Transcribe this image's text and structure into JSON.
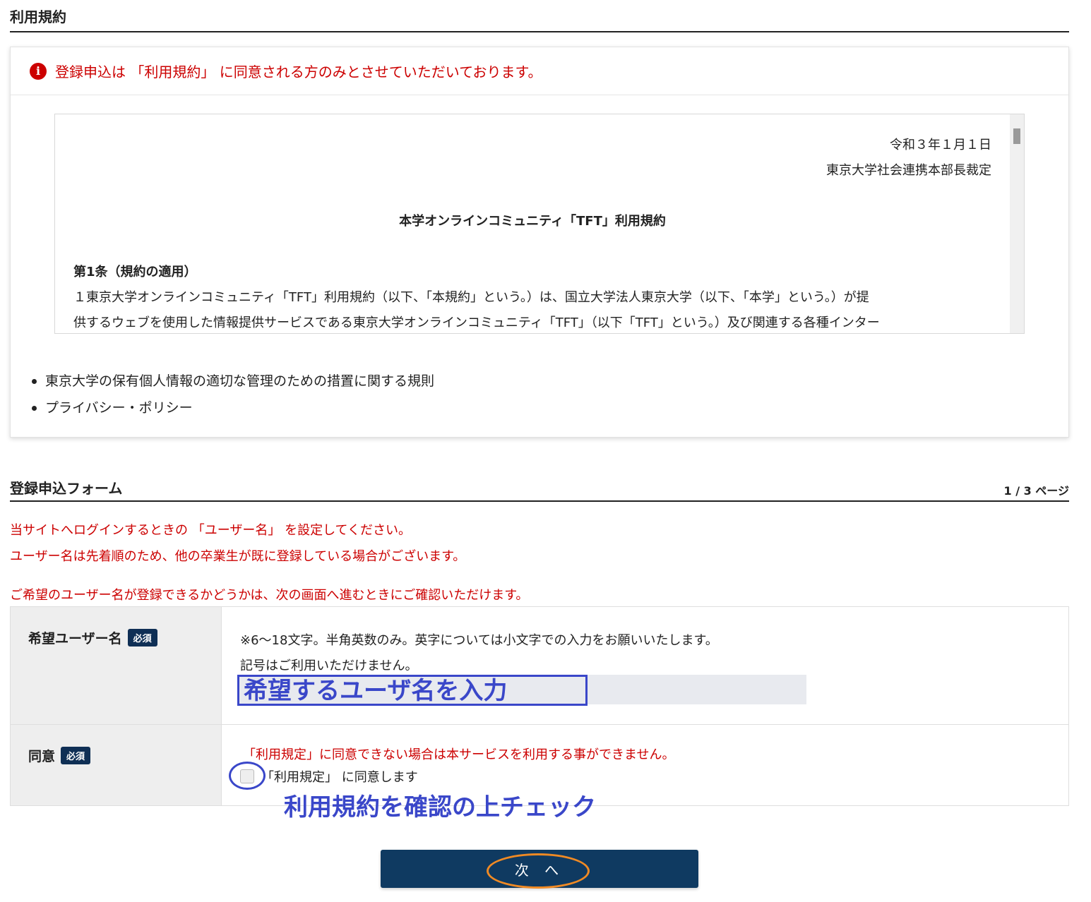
{
  "terms_section": {
    "title": "利用規約",
    "notice": "登録申込は 「利用規約」 に同意される方のみとさせていただいております。",
    "document": {
      "date": "令和３年１月１日",
      "authority": "東京大学社会連携本部長裁定",
      "heading": "本学オンラインコミュニティ「TFT」利用規約",
      "article_title": "第1条（規約の適用）",
      "article_line1": "１東京大学オンラインコミュニティ「TFT」利用規約（以下、「本規約」という。）は、国立大学法人東京大学（以下、「本学」という。）が提",
      "article_line2": "供するウェブを使用した情報提供サービスである東京大学オンラインコミュニティ「TFT」（以下「TFT」という。）及び関連する各種インター"
    },
    "links": [
      "東京大学の保有個人情報の適切な管理のための措置に関する規則",
      "プライバシー・ポリシー"
    ]
  },
  "form_section": {
    "title": "登録申込フォーム",
    "page_indicator": "1 / 3 ページ",
    "instructions": [
      "当サイトへログインするときの 「ユーザー名」 を設定してください。",
      "ユーザー名は先着順のため、他の卒業生が既に登録している場合がございます。",
      "",
      "ご希望のユーザー名が登録できるかどうかは、次の画面へ進むときにご確認いただけます。"
    ],
    "username": {
      "label": "希望ユーザー名",
      "required": "必須",
      "hint1": "※6〜18文字。半角英数のみ。英字については小文字での入力をお願いいたします。",
      "hint2": "記号はご利用いただけません。",
      "annotation": "希望するユーザ名を入力"
    },
    "agree": {
      "label": "同意",
      "required": "必須",
      "warning": "「利用規定」に同意できない場合は本サービスを利用する事ができません。",
      "checkbox_label": "「利用規定」 に同意します",
      "annotation": "利用規約を確認の上チェック"
    },
    "next_button": "次 へ"
  },
  "colors": {
    "notice_red": "#cc0000",
    "navy": "#0f3a61",
    "annotation_blue": "#3a47c9",
    "annotation_orange": "#f08a24"
  }
}
